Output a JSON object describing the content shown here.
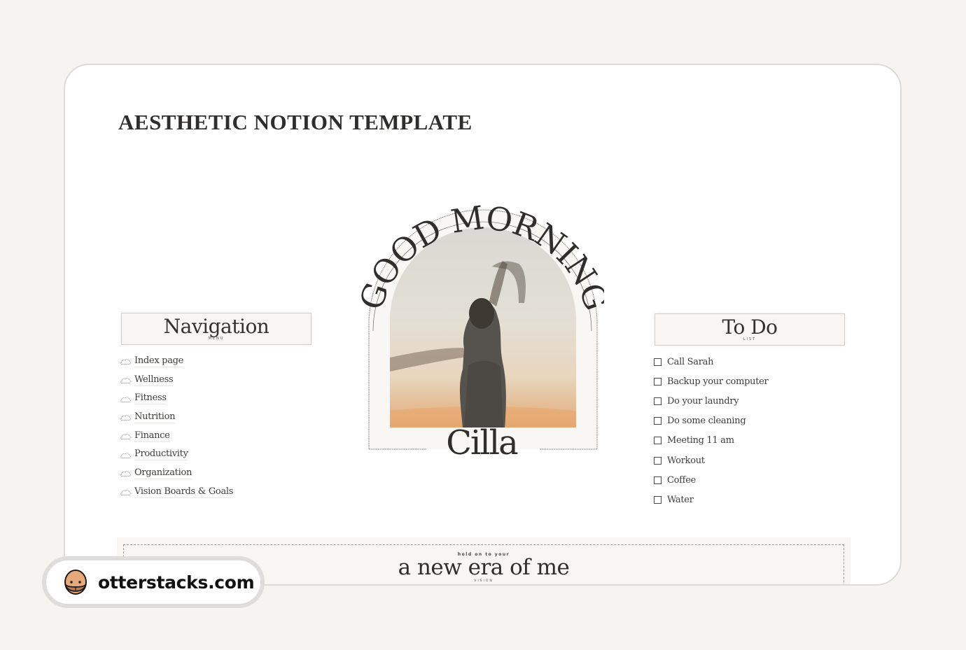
{
  "page": {
    "title": "AESTHETIC NOTION TEMPLATE"
  },
  "navigation": {
    "title": "Navigation",
    "subtitle": "MENU",
    "icon": "cloud-icon",
    "items": [
      {
        "label": "Index page"
      },
      {
        "label": "Wellness"
      },
      {
        "label": "Fitness"
      },
      {
        "label": "Nutrition"
      },
      {
        "label": "Finance"
      },
      {
        "label": "Productivity"
      },
      {
        "label": "Organization"
      },
      {
        "label": "Vision Boards & Goals"
      }
    ]
  },
  "greeting": {
    "arc_text": "GOOD MORNING",
    "name": "Cilla",
    "photo": "dancing-woman-sunset-photo"
  },
  "todo": {
    "title": "To Do",
    "subtitle": "LIST",
    "items": [
      {
        "label": "Call Sarah",
        "checked": false
      },
      {
        "label": "Backup your computer",
        "checked": false
      },
      {
        "label": "Do your laundry",
        "checked": false
      },
      {
        "label": "Do some cleaning",
        "checked": false
      },
      {
        "label": "Meeting 11 am",
        "checked": false
      },
      {
        "label": "Workout",
        "checked": false
      },
      {
        "label": "Coffee",
        "checked": false
      },
      {
        "label": "Water",
        "checked": false
      }
    ]
  },
  "banner": {
    "kicker": "hold on to your",
    "title": "a new era of me",
    "subtitle": "VISION"
  },
  "watermark": {
    "text": "otterstacks.com",
    "icon": "otter-logo-icon"
  },
  "colors": {
    "background": "#f5f4f1",
    "card": "#ffffff",
    "text": "#2f2e2c",
    "panel": "#f7f6f3"
  }
}
